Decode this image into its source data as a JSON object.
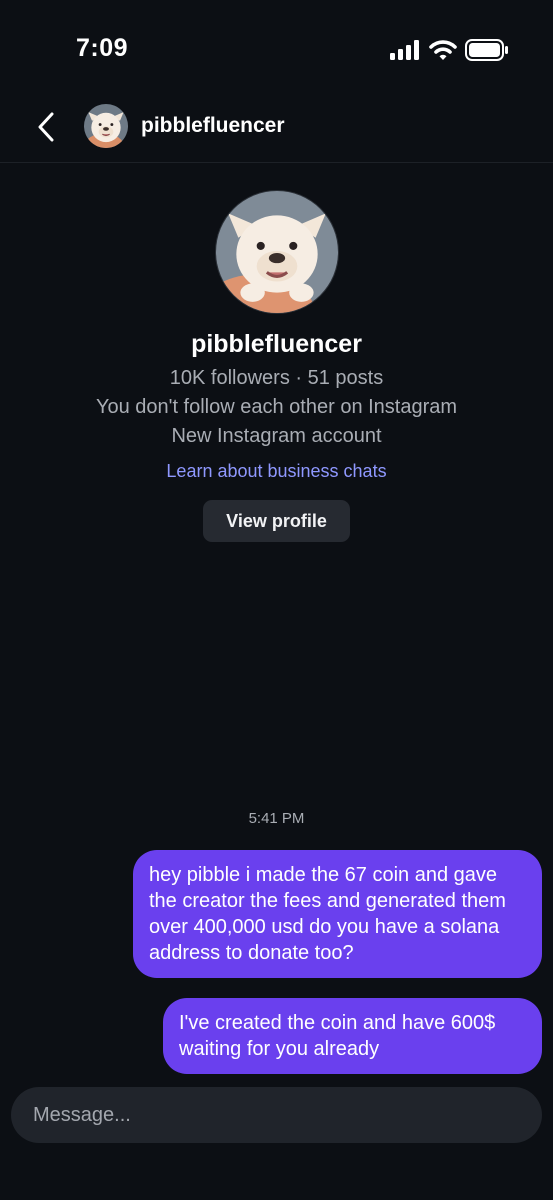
{
  "status_bar": {
    "time": "7:09",
    "icons": [
      "cellular-signal-icon",
      "wifi-icon",
      "battery-icon"
    ]
  },
  "header": {
    "back_icon": "chevron-left-icon",
    "username": "pibblefluencer"
  },
  "profile": {
    "name": "pibblefluencer",
    "stats": "10K followers · 51 posts",
    "follow_status": "You don't follow each other on Instagram",
    "account_note": "New Instagram account",
    "business_link": "Learn about business chats",
    "view_profile_label": "View profile"
  },
  "conversation": {
    "timestamp": "5:41 PM",
    "messages": [
      {
        "sender": "me",
        "text": "hey pibble i made the 67 coin and gave the creator the fees and generated them over 400,000 usd do you have a solana address to donate too?"
      },
      {
        "sender": "me",
        "text": "I've created the coin and have 600$ waiting for you already"
      }
    ]
  },
  "composer": {
    "placeholder": "Message..."
  },
  "colors": {
    "background": "#0c0f14",
    "bubble": "#6a40ee",
    "link": "#8f98ff",
    "secondary_text": "#a9adb4"
  }
}
